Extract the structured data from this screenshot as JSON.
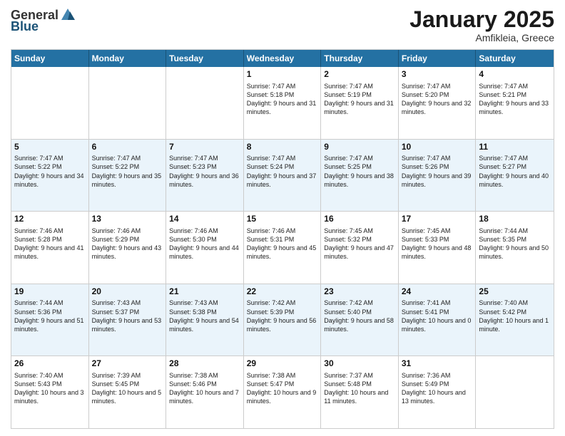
{
  "header": {
    "logo_general": "General",
    "logo_blue": "Blue",
    "month_title": "January 2025",
    "location": "Amfikleia, Greece"
  },
  "days_of_week": [
    "Sunday",
    "Monday",
    "Tuesday",
    "Wednesday",
    "Thursday",
    "Friday",
    "Saturday"
  ],
  "weeks": [
    [
      {
        "day": "",
        "sunrise": "",
        "sunset": "",
        "daylight": "",
        "empty": true
      },
      {
        "day": "",
        "sunrise": "",
        "sunset": "",
        "daylight": "",
        "empty": true
      },
      {
        "day": "",
        "sunrise": "",
        "sunset": "",
        "daylight": "",
        "empty": true
      },
      {
        "day": "1",
        "sunrise": "Sunrise: 7:47 AM",
        "sunset": "Sunset: 5:18 PM",
        "daylight": "Daylight: 9 hours and 31 minutes.",
        "empty": false
      },
      {
        "day": "2",
        "sunrise": "Sunrise: 7:47 AM",
        "sunset": "Sunset: 5:19 PM",
        "daylight": "Daylight: 9 hours and 31 minutes.",
        "empty": false
      },
      {
        "day": "3",
        "sunrise": "Sunrise: 7:47 AM",
        "sunset": "Sunset: 5:20 PM",
        "daylight": "Daylight: 9 hours and 32 minutes.",
        "empty": false
      },
      {
        "day": "4",
        "sunrise": "Sunrise: 7:47 AM",
        "sunset": "Sunset: 5:21 PM",
        "daylight": "Daylight: 9 hours and 33 minutes.",
        "empty": false
      }
    ],
    [
      {
        "day": "5",
        "sunrise": "Sunrise: 7:47 AM",
        "sunset": "Sunset: 5:22 PM",
        "daylight": "Daylight: 9 hours and 34 minutes.",
        "empty": false
      },
      {
        "day": "6",
        "sunrise": "Sunrise: 7:47 AM",
        "sunset": "Sunset: 5:22 PM",
        "daylight": "Daylight: 9 hours and 35 minutes.",
        "empty": false
      },
      {
        "day": "7",
        "sunrise": "Sunrise: 7:47 AM",
        "sunset": "Sunset: 5:23 PM",
        "daylight": "Daylight: 9 hours and 36 minutes.",
        "empty": false
      },
      {
        "day": "8",
        "sunrise": "Sunrise: 7:47 AM",
        "sunset": "Sunset: 5:24 PM",
        "daylight": "Daylight: 9 hours and 37 minutes.",
        "empty": false
      },
      {
        "day": "9",
        "sunrise": "Sunrise: 7:47 AM",
        "sunset": "Sunset: 5:25 PM",
        "daylight": "Daylight: 9 hours and 38 minutes.",
        "empty": false
      },
      {
        "day": "10",
        "sunrise": "Sunrise: 7:47 AM",
        "sunset": "Sunset: 5:26 PM",
        "daylight": "Daylight: 9 hours and 39 minutes.",
        "empty": false
      },
      {
        "day": "11",
        "sunrise": "Sunrise: 7:47 AM",
        "sunset": "Sunset: 5:27 PM",
        "daylight": "Daylight: 9 hours and 40 minutes.",
        "empty": false
      }
    ],
    [
      {
        "day": "12",
        "sunrise": "Sunrise: 7:46 AM",
        "sunset": "Sunset: 5:28 PM",
        "daylight": "Daylight: 9 hours and 41 minutes.",
        "empty": false
      },
      {
        "day": "13",
        "sunrise": "Sunrise: 7:46 AM",
        "sunset": "Sunset: 5:29 PM",
        "daylight": "Daylight: 9 hours and 43 minutes.",
        "empty": false
      },
      {
        "day": "14",
        "sunrise": "Sunrise: 7:46 AM",
        "sunset": "Sunset: 5:30 PM",
        "daylight": "Daylight: 9 hours and 44 minutes.",
        "empty": false
      },
      {
        "day": "15",
        "sunrise": "Sunrise: 7:46 AM",
        "sunset": "Sunset: 5:31 PM",
        "daylight": "Daylight: 9 hours and 45 minutes.",
        "empty": false
      },
      {
        "day": "16",
        "sunrise": "Sunrise: 7:45 AM",
        "sunset": "Sunset: 5:32 PM",
        "daylight": "Daylight: 9 hours and 47 minutes.",
        "empty": false
      },
      {
        "day": "17",
        "sunrise": "Sunrise: 7:45 AM",
        "sunset": "Sunset: 5:33 PM",
        "daylight": "Daylight: 9 hours and 48 minutes.",
        "empty": false
      },
      {
        "day": "18",
        "sunrise": "Sunrise: 7:44 AM",
        "sunset": "Sunset: 5:35 PM",
        "daylight": "Daylight: 9 hours and 50 minutes.",
        "empty": false
      }
    ],
    [
      {
        "day": "19",
        "sunrise": "Sunrise: 7:44 AM",
        "sunset": "Sunset: 5:36 PM",
        "daylight": "Daylight: 9 hours and 51 minutes.",
        "empty": false
      },
      {
        "day": "20",
        "sunrise": "Sunrise: 7:43 AM",
        "sunset": "Sunset: 5:37 PM",
        "daylight": "Daylight: 9 hours and 53 minutes.",
        "empty": false
      },
      {
        "day": "21",
        "sunrise": "Sunrise: 7:43 AM",
        "sunset": "Sunset: 5:38 PM",
        "daylight": "Daylight: 9 hours and 54 minutes.",
        "empty": false
      },
      {
        "day": "22",
        "sunrise": "Sunrise: 7:42 AM",
        "sunset": "Sunset: 5:39 PM",
        "daylight": "Daylight: 9 hours and 56 minutes.",
        "empty": false
      },
      {
        "day": "23",
        "sunrise": "Sunrise: 7:42 AM",
        "sunset": "Sunset: 5:40 PM",
        "daylight": "Daylight: 9 hours and 58 minutes.",
        "empty": false
      },
      {
        "day": "24",
        "sunrise": "Sunrise: 7:41 AM",
        "sunset": "Sunset: 5:41 PM",
        "daylight": "Daylight: 10 hours and 0 minutes.",
        "empty": false
      },
      {
        "day": "25",
        "sunrise": "Sunrise: 7:40 AM",
        "sunset": "Sunset: 5:42 PM",
        "daylight": "Daylight: 10 hours and 1 minute.",
        "empty": false
      }
    ],
    [
      {
        "day": "26",
        "sunrise": "Sunrise: 7:40 AM",
        "sunset": "Sunset: 5:43 PM",
        "daylight": "Daylight: 10 hours and 3 minutes.",
        "empty": false
      },
      {
        "day": "27",
        "sunrise": "Sunrise: 7:39 AM",
        "sunset": "Sunset: 5:45 PM",
        "daylight": "Daylight: 10 hours and 5 minutes.",
        "empty": false
      },
      {
        "day": "28",
        "sunrise": "Sunrise: 7:38 AM",
        "sunset": "Sunset: 5:46 PM",
        "daylight": "Daylight: 10 hours and 7 minutes.",
        "empty": false
      },
      {
        "day": "29",
        "sunrise": "Sunrise: 7:38 AM",
        "sunset": "Sunset: 5:47 PM",
        "daylight": "Daylight: 10 hours and 9 minutes.",
        "empty": false
      },
      {
        "day": "30",
        "sunrise": "Sunrise: 7:37 AM",
        "sunset": "Sunset: 5:48 PM",
        "daylight": "Daylight: 10 hours and 11 minutes.",
        "empty": false
      },
      {
        "day": "31",
        "sunrise": "Sunrise: 7:36 AM",
        "sunset": "Sunset: 5:49 PM",
        "daylight": "Daylight: 10 hours and 13 minutes.",
        "empty": false
      },
      {
        "day": "",
        "sunrise": "",
        "sunset": "",
        "daylight": "",
        "empty": true
      }
    ]
  ],
  "row_shading": [
    false,
    true,
    false,
    true,
    false
  ]
}
